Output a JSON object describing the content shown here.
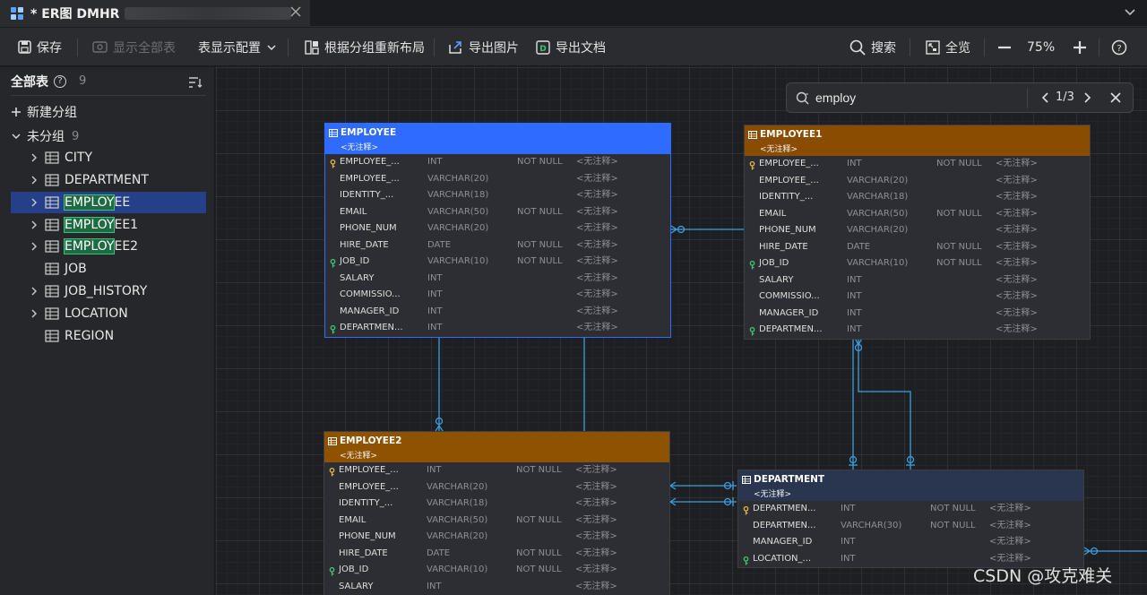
{
  "tab": {
    "title": "* ER图 DMHR",
    "icon": "er-diagram-icon"
  },
  "toolbar": {
    "save": "保存",
    "show_all": "显示全部表",
    "table_display": "表显示配置",
    "relayout": "根据分组重新布局",
    "export_image": "导出图片",
    "export_doc": "导出文档",
    "search": "搜索",
    "overview": "全览",
    "zoom": "75%"
  },
  "sidebar": {
    "title": "全部表",
    "count": "9",
    "new_group": "新建分组",
    "group_name": "未分组",
    "group_count": "9",
    "search_highlight": "EMPLOY",
    "items": [
      {
        "pre": "",
        "hl": "",
        "post": "CITY",
        "expandable": true,
        "selected": false
      },
      {
        "pre": "",
        "hl": "",
        "post": "DEPARTMENT",
        "expandable": true,
        "selected": false
      },
      {
        "pre": "",
        "hl": "EMPLOY",
        "post": "EE",
        "expandable": true,
        "selected": true
      },
      {
        "pre": "",
        "hl": "EMPLOY",
        "post": "EE1",
        "expandable": true,
        "selected": false
      },
      {
        "pre": "",
        "hl": "EMPLOY",
        "post": "EE2",
        "expandable": true,
        "selected": false
      },
      {
        "pre": "",
        "hl": "",
        "post": "JOB",
        "expandable": false,
        "selected": false
      },
      {
        "pre": "",
        "hl": "",
        "post": "JOB_HISTORY",
        "expandable": true,
        "selected": false
      },
      {
        "pre": "",
        "hl": "",
        "post": "LOCATION",
        "expandable": true,
        "selected": false
      },
      {
        "pre": "",
        "hl": "",
        "post": "REGION",
        "expandable": false,
        "selected": false
      }
    ]
  },
  "search": {
    "value": "employ",
    "position": "1/3"
  },
  "colors": {
    "header_blue": "#2f6bff",
    "header_orange": "#8a4c00",
    "header_orange2": "#8f5200",
    "header_navy": "#2a3650",
    "connector": "#3a9fe0",
    "pk_key": "#e3b341",
    "fk_key": "#3fc46f",
    "selection": "#254088"
  },
  "entities": [
    {
      "id": "employee",
      "name": "EMPLOYEE",
      "comment": "<无注释>",
      "header": "blue",
      "columns": [
        {
          "key": "pk",
          "name": "EMPLOYEE_...",
          "type": "INT",
          "null": "NOT NULL",
          "comment": "<无注释>"
        },
        {
          "key": "",
          "name": "EMPLOYEE_...",
          "type": "VARCHAR(20)",
          "null": "",
          "comment": "<无注释>"
        },
        {
          "key": "",
          "name": "IDENTITY_...",
          "type": "VARCHAR(18)",
          "null": "",
          "comment": "<无注释>"
        },
        {
          "key": "",
          "name": "EMAIL",
          "type": "VARCHAR(50)",
          "null": "NOT NULL",
          "comment": "<无注释>"
        },
        {
          "key": "",
          "name": "PHONE_NUM",
          "type": "VARCHAR(20)",
          "null": "",
          "comment": "<无注释>"
        },
        {
          "key": "",
          "name": "HIRE_DATE",
          "type": "DATE",
          "null": "NOT NULL",
          "comment": "<无注释>"
        },
        {
          "key": "fk",
          "name": "JOB_ID",
          "type": "VARCHAR(10)",
          "null": "NOT NULL",
          "comment": "<无注释>"
        },
        {
          "key": "",
          "name": "SALARY",
          "type": "INT",
          "null": "",
          "comment": "<无注释>"
        },
        {
          "key": "",
          "name": "COMMISSIO...",
          "type": "INT",
          "null": "",
          "comment": "<无注释>"
        },
        {
          "key": "",
          "name": "MANAGER_ID",
          "type": "INT",
          "null": "",
          "comment": "<无注释>"
        },
        {
          "key": "fk",
          "name": "DEPARTMEN...",
          "type": "INT",
          "null": "",
          "comment": "<无注释>"
        }
      ]
    },
    {
      "id": "employee1",
      "name": "EMPLOYEE1",
      "comment": "<无注释>",
      "header": "orange",
      "columns": [
        {
          "key": "pk",
          "name": "EMPLOYEE_...",
          "type": "INT",
          "null": "NOT NULL",
          "comment": "<无注释>"
        },
        {
          "key": "",
          "name": "EMPLOYEE_...",
          "type": "VARCHAR(20)",
          "null": "",
          "comment": "<无注释>"
        },
        {
          "key": "",
          "name": "IDENTITY_...",
          "type": "VARCHAR(18)",
          "null": "",
          "comment": "<无注释>"
        },
        {
          "key": "",
          "name": "EMAIL",
          "type": "VARCHAR(50)",
          "null": "NOT NULL",
          "comment": "<无注释>"
        },
        {
          "key": "",
          "name": "PHONE_NUM",
          "type": "VARCHAR(20)",
          "null": "",
          "comment": "<无注释>"
        },
        {
          "key": "",
          "name": "HIRE_DATE",
          "type": "DATE",
          "null": "NOT NULL",
          "comment": "<无注释>"
        },
        {
          "key": "fk",
          "name": "JOB_ID",
          "type": "VARCHAR(10)",
          "null": "NOT NULL",
          "comment": "<无注释>"
        },
        {
          "key": "",
          "name": "SALARY",
          "type": "INT",
          "null": "",
          "comment": "<无注释>"
        },
        {
          "key": "",
          "name": "COMMISSIO...",
          "type": "INT",
          "null": "",
          "comment": "<无注释>"
        },
        {
          "key": "",
          "name": "MANAGER_ID",
          "type": "INT",
          "null": "",
          "comment": "<无注释>"
        },
        {
          "key": "fk",
          "name": "DEPARTMEN...",
          "type": "INT",
          "null": "",
          "comment": "<无注释>"
        }
      ]
    },
    {
      "id": "employee2",
      "name": "EMPLOYEE2",
      "comment": "<无注释>",
      "header": "orange2",
      "columns": [
        {
          "key": "pk",
          "name": "EMPLOYEE_...",
          "type": "INT",
          "null": "NOT NULL",
          "comment": "<无注释>"
        },
        {
          "key": "",
          "name": "EMPLOYEE_...",
          "type": "VARCHAR(20)",
          "null": "",
          "comment": "<无注释>"
        },
        {
          "key": "",
          "name": "IDENTITY_...",
          "type": "VARCHAR(18)",
          "null": "",
          "comment": "<无注释>"
        },
        {
          "key": "",
          "name": "EMAIL",
          "type": "VARCHAR(50)",
          "null": "NOT NULL",
          "comment": "<无注释>"
        },
        {
          "key": "",
          "name": "PHONE_NUM",
          "type": "VARCHAR(20)",
          "null": "",
          "comment": "<无注释>"
        },
        {
          "key": "",
          "name": "HIRE_DATE",
          "type": "DATE",
          "null": "NOT NULL",
          "comment": "<无注释>"
        },
        {
          "key": "fk",
          "name": "JOB_ID",
          "type": "VARCHAR(10)",
          "null": "NOT NULL",
          "comment": "<无注释>"
        },
        {
          "key": "",
          "name": "SALARY",
          "type": "INT",
          "null": "",
          "comment": "<无注释>"
        }
      ]
    },
    {
      "id": "department",
      "name": "DEPARTMENT",
      "comment": "<无注释>",
      "header": "navy",
      "columns": [
        {
          "key": "pk",
          "name": "DEPARTMEN...",
          "type": "INT",
          "null": "NOT NULL",
          "comment": "<无注释>"
        },
        {
          "key": "",
          "name": "DEPARTMEN...",
          "type": "VARCHAR(30)",
          "null": "NOT NULL",
          "comment": "<无注释>"
        },
        {
          "key": "",
          "name": "MANAGER_ID",
          "type": "INT",
          "null": "",
          "comment": "<无注释>"
        },
        {
          "key": "fk",
          "name": "LOCATION_...",
          "type": "INT",
          "null": "",
          "comment": "<无注释>"
        }
      ]
    }
  ],
  "watermark": "CSDN @攻克难关"
}
